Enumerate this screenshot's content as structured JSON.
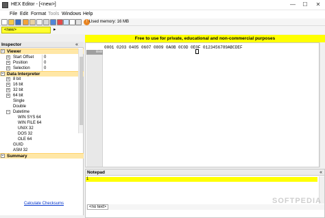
{
  "app": {
    "title": "HEX Editor - [<new>]",
    "window_controls": {
      "minimize": "—",
      "maximize": "☐",
      "close": "✕"
    }
  },
  "menu": [
    "File",
    "Edit",
    "Format",
    "Tools",
    "Windows",
    "Help"
  ],
  "toolbar": {
    "status_icon": "!",
    "memory": "Used memory: 16 MB",
    "buttons": [
      "new-icon",
      "open-icon",
      "save-icon",
      "print-icon",
      "cut-icon",
      "copy-icon",
      "paste-icon",
      "undo-icon",
      "redo-icon",
      "find-icon",
      "goto-icon",
      "compare-icon",
      "settings-icon",
      "help-icon"
    ]
  },
  "tabs": {
    "active": "<new>",
    "arrow": "▸"
  },
  "banner": "Free to use for private, educational and non-commercial purposes",
  "hex": {
    "ruler": "0001 0203 0405 0607 0809 0A0B 0C0D 0E0F  0123456789ABCDEF",
    "first_offset": "0x0"
  },
  "inspector": {
    "title": "Inspector",
    "collapse": "«",
    "sections": [
      {
        "name": "Viewer",
        "rows": [
          {
            "label": "Start Offset",
            "value": "0",
            "expandable": true
          },
          {
            "label": "Position",
            "value": "0",
            "expandable": true
          },
          {
            "label": "Selection",
            "value": "0",
            "expandable": true
          }
        ]
      },
      {
        "name": "Data Interpreter",
        "rows": [
          {
            "label": "8 bit",
            "expandable": true
          },
          {
            "label": "16 bit",
            "expandable": true
          },
          {
            "label": "32 bit",
            "expandable": true
          },
          {
            "label": "64 bit",
            "expandable": true
          },
          {
            "label": "Single",
            "expandable": false
          },
          {
            "label": "Double",
            "expandable": false
          },
          {
            "label": "Datetime",
            "expandable": true
          },
          {
            "label": "WIN SYS 64",
            "indent": true
          },
          {
            "label": "WIN FILE 64",
            "indent": true
          },
          {
            "label": "UNIX 32",
            "indent": true
          },
          {
            "label": "DOS 32",
            "indent": true
          },
          {
            "label": "OLE 64",
            "indent": true
          },
          {
            "label": "GUID",
            "expandable": false
          },
          {
            "label": "ASM 32",
            "expandable": false
          }
        ]
      },
      {
        "name": "Summary",
        "rows": []
      }
    ],
    "checksum_link": "Calculate Checksums"
  },
  "notepad": {
    "title": "Notepad",
    "collapse": "«",
    "line_number": "1",
    "status": "<no text>"
  },
  "watermark": "SOFTPEDIA"
}
